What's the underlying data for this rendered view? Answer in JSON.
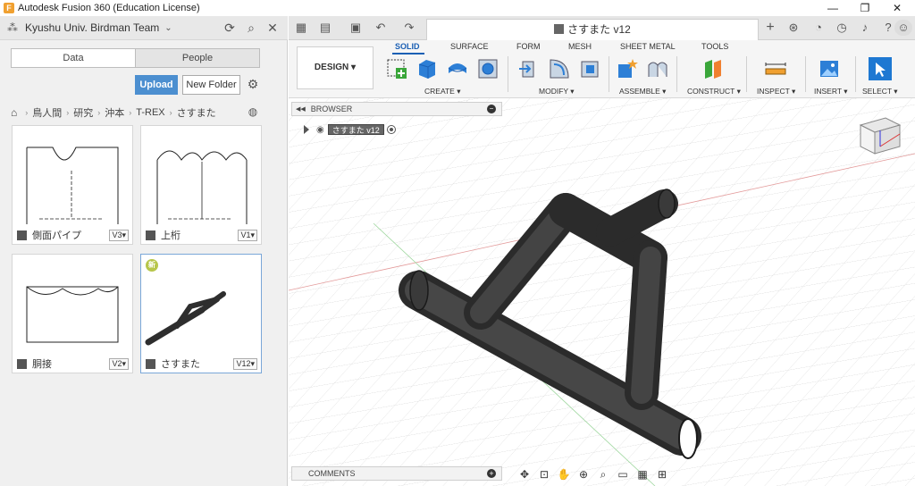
{
  "window": {
    "title": "Autodesk Fusion 360 (Education License)",
    "app_icon": "F",
    "controls": [
      "—",
      "❐",
      "✕"
    ]
  },
  "data_panel": {
    "team_name": "Kyushu Univ. Birdman Team",
    "tabs": [
      {
        "label": "Data",
        "active": true
      },
      {
        "label": "People",
        "active": false
      }
    ],
    "upload_label": "Upload",
    "new_folder_label": "New Folder",
    "breadcrumb": [
      "鳥人間",
      "研究",
      "沖本",
      "T-REX",
      "さすまた"
    ],
    "files": [
      {
        "name": "側面パイプ",
        "version": "V3▾"
      },
      {
        "name": "上桁",
        "version": "V1▾"
      },
      {
        "name": "胴接",
        "version": "V2▾"
      },
      {
        "name": "さすまた",
        "version": "V12▾",
        "badge": "新"
      }
    ]
  },
  "document": {
    "tab_title": "さすまた v12"
  },
  "ribbon": {
    "workspace": "DESIGN ▾",
    "tabs": [
      "SOLID",
      "SURFACE",
      "FORM",
      "MESH",
      "SHEET METAL",
      "TOOLS"
    ],
    "groups": [
      "CREATE ▾",
      "MODIFY ▾",
      "ASSEMBLE ▾",
      "CONSTRUCT ▾",
      "INSPECT ▾",
      "INSERT ▾",
      "SELECT ▾"
    ]
  },
  "browser": {
    "label": "BROWSER",
    "root_component": "さすまた v12"
  },
  "comments": {
    "label": "COMMENTS"
  },
  "colors": {
    "accent": "#1a5fb4",
    "upload_button": "#4c8fd0",
    "model": "#3a3a3a"
  }
}
